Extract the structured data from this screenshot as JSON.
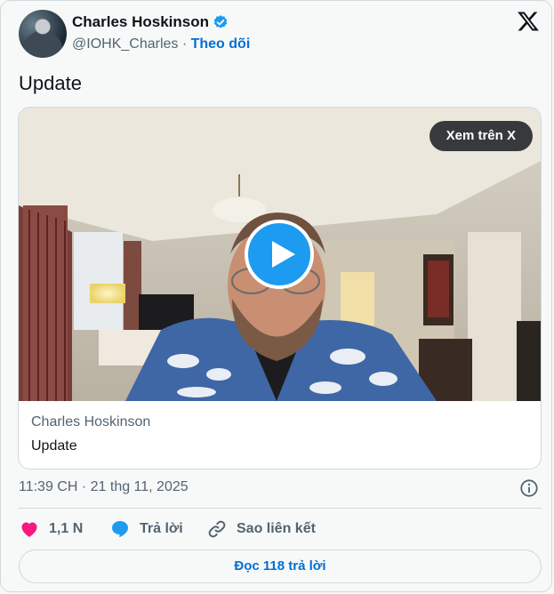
{
  "author": {
    "name": "Charles Hoskinson",
    "handle": "@IOHK_Charles",
    "separator": " · ",
    "follow_label": "Theo dõi"
  },
  "tweet": {
    "text": "Update",
    "timestamp": "11:39 CH · 21 thg 11, 2025"
  },
  "media": {
    "view_on_x_label": "Xem trên X",
    "caption_author": "Charles Hoskinson",
    "caption_title": "Update"
  },
  "actions": {
    "likes": "1,1 N",
    "reply_label": "Trả lời",
    "copy_link_label": "Sao liên kết"
  },
  "read_replies_label": "Đọc 118 trả lời",
  "colors": {
    "accent": "#1d9bf0",
    "link": "#006fd6",
    "like": "#f91880",
    "muted": "#536471"
  },
  "icons": [
    "verified-badge-icon",
    "x-logo-icon",
    "play-icon",
    "info-icon",
    "heart-icon",
    "reply-bubble-icon",
    "link-icon"
  ]
}
